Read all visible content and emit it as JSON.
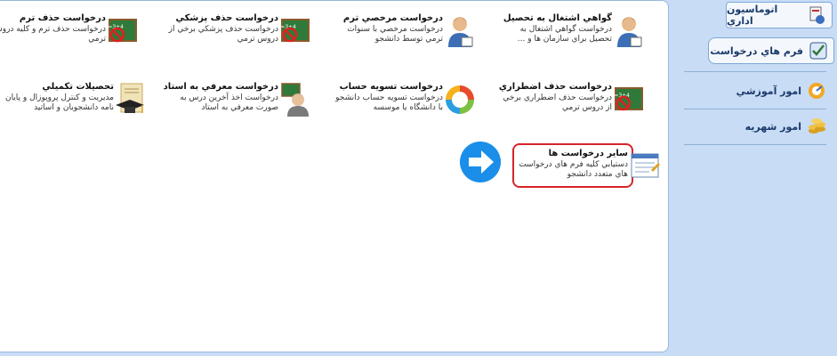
{
  "tiles": [
    {
      "title": "گواهي اشتغال به تحصيل",
      "desc": "درخواست گواهي اشتغال به تحصيل براي سازمان ها و ...",
      "icon": "student-person-icon"
    },
    {
      "title": "درخواست مرخصي ترم",
      "desc": "درخواست مرخصي با سنوات ترمي توسط دانشجو",
      "icon": "student-person-icon"
    },
    {
      "title": "درخواست حذف پزشكي",
      "desc": "درخواست حذف پزشكي برخي از دروس ترمي",
      "icon": "blackboard-no-icon"
    },
    {
      "title": "درخواست حذف ترم",
      "desc": "درخواست حذف ترم و كليه دروس ترمي",
      "icon": "blackboard-no-icon"
    },
    {
      "title": "درخواست حذف اضطراري",
      "desc": "درخواست حذف اضطراري برخي از دروس ترمي",
      "icon": "blackboard-no-icon"
    },
    {
      "title": "درخواست تسويه حساب",
      "desc": "درخواست تسويه حساب دانشجو با دانشگاه يا موسسه",
      "icon": "cycle-arrows-icon"
    },
    {
      "title": "درخواست معرفي به استاد",
      "desc": "درخواست اخذ آخرين درس به صورت معرفي به استاد",
      "icon": "teacher-icon"
    },
    {
      "title": "تحصيلات تكميلي",
      "desc": "مديريت و كنترل پروپوزال و پايان نامه دانشجويان و اساتيد",
      "icon": "graduation-cap-icon"
    },
    {
      "title": "ساير درخواست ها",
      "desc": "دستيابي كليه فرم هاي درخواست هاي متعدد دانشجو",
      "icon": "form-document-icon"
    }
  ],
  "sidebar": {
    "automation_label": "اتوماسيون اداري",
    "forms_label": "فرم هاي درخواست",
    "education_label": "امور آموزشي",
    "tuition_label": "امور شهريه"
  }
}
